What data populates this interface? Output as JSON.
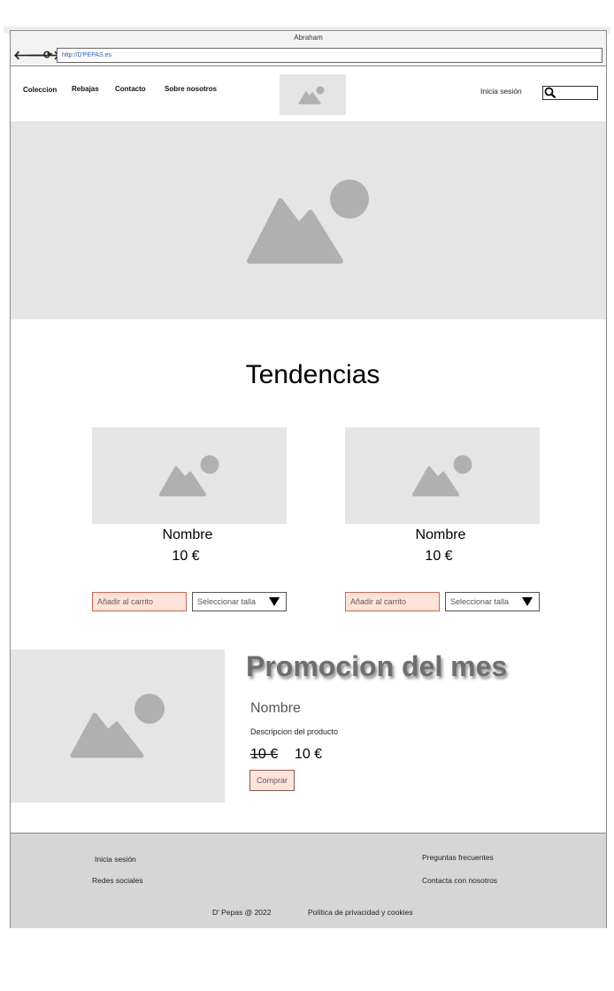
{
  "browser": {
    "title": "Abraham",
    "url": "http://D'PEPAS.es",
    "back_icon": "arrow-left-icon",
    "forward_icon": "arrow-right-icon",
    "reload_icon": "reload-icon"
  },
  "header": {
    "menu": [
      "Coleccion",
      "Rebajas",
      "Contacto",
      "Sobre nosotros"
    ],
    "logo_icon": "image-placeholder-icon",
    "login_label": "Inicia sesión",
    "search_icon": "search-icon"
  },
  "hero": {
    "icon": "image-placeholder-icon"
  },
  "trends": {
    "title": "Tendencias",
    "products": [
      {
        "name": "Nombre",
        "price": "10 €",
        "add_to_cart": "Añadir al carrito",
        "size_select": "Seleccionar talla"
      },
      {
        "name": "Nombre",
        "price": "10 €",
        "add_to_cart": "Añadir al carrito",
        "size_select": "Seleccionar talla"
      }
    ]
  },
  "promo": {
    "title": "Promocion del mes",
    "name": "Nombre",
    "description": "Descripcion del producto",
    "old_price": "10 €",
    "new_price": "10 €",
    "buy_label": "Comprar"
  },
  "footer": {
    "login": "Inicia sesión",
    "social": "Redes sociales",
    "faq": "Preguntas frecuentes",
    "contact": "Contacta con nosotros",
    "copyright": "D' Pepas @ 2022",
    "privacy": "Política de privacidad y cookies"
  },
  "colors": {
    "placeholder_bg": "#e5e5e5",
    "placeholder_icon": "#b0b0b0",
    "button_bg": "#fde3d9",
    "footer_bg": "#d6d6d6"
  }
}
